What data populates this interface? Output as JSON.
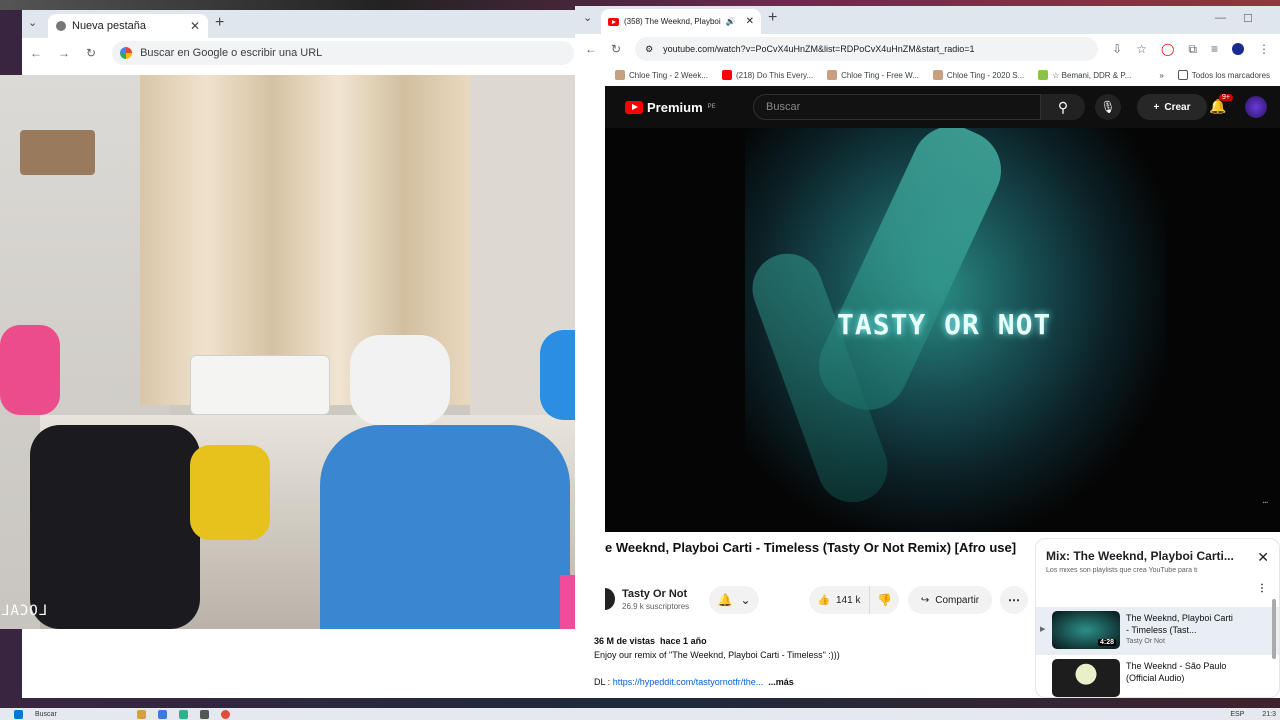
{
  "left_window": {
    "tab_title": "Nueva pestaña",
    "omnibox_placeholder": "Buscar en Google o escribir una URL",
    "webcam_overlay": "LOCAL"
  },
  "right_window": {
    "tab_title": "(358) The Weeknd, Playboi",
    "url": "youtube.com/watch?v=PoCvX4uHnZM&list=RDPoCvX4uHnZM&start_radio=1",
    "bookmarks": [
      "Chloe Ting - 2 Week...",
      "(218) Do This Every...",
      "Chloe Ting - Free W...",
      "Chloe Ting - 2020 S...",
      "☆ Bemani, DDR & P...",
      "Todos los marcadores"
    ]
  },
  "youtube": {
    "logo": "Premium",
    "logo_region": "PE",
    "search_placeholder": "Buscar",
    "create_label": "Crear",
    "notif_badge": "9+",
    "video_overlay_text": "TASTY OR NOT",
    "video_title": "e Weeknd, Playboi Carti - Timeless (Tasty Or Not Remix) [Afro use]",
    "channel_name": "Tasty Or Not",
    "subscribers": "26.9 k suscriptores",
    "likes": "141 k",
    "share_label": "Compartir",
    "views": "36 M de vistas",
    "age": "hace 1 año",
    "description_line": "Enjoy our remix of \"The Weeknd, Playboi Carti - Timeless\" :)))",
    "dl_label": "DL :",
    "dl_link": "https://hypeddit.com/tastyornotfr/the...",
    "more_label": "...más"
  },
  "mix_panel": {
    "title": "Mix: The Weeknd, Playboi Carti...",
    "subtitle": "Los mixes son playlists que crea YouTube para ti",
    "items": [
      {
        "title": "The Weeknd, Playboi Carti - Timeless (Tast...",
        "channel": "Tasty Or Not",
        "duration": "4:28"
      },
      {
        "title": "The Weeknd - São Paulo (Official Audio)",
        "channel": ""
      }
    ]
  },
  "taskbar": {
    "search": "Buscar",
    "lang": "ESP",
    "time": "21:3"
  },
  "colors": {
    "yt_red": "#ff0000",
    "link_blue": "#065fd4",
    "dark_bar": "#0f0f0f"
  }
}
